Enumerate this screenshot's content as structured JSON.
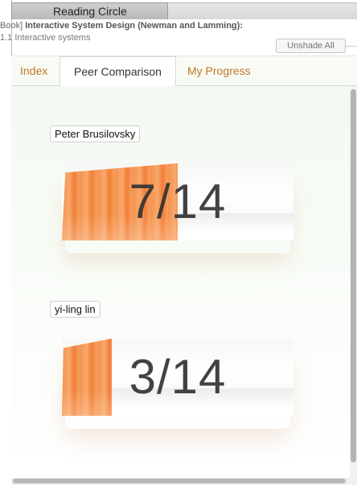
{
  "window": {
    "title": "Reading Circle"
  },
  "header": {
    "breadcrumb_prefix": "Book] ",
    "book_title": "Interactive System Design (Newman and Lamming):",
    "section": "1.1 Interactive systems",
    "unshade_label": "Unshade All"
  },
  "tabs": [
    {
      "label": "Index",
      "active": false
    },
    {
      "label": "Peer Comparison",
      "active": true
    },
    {
      "label": "My Progress",
      "active": false
    }
  ],
  "peers": [
    {
      "name": "Peter Brusilovsky",
      "completed": 7,
      "total": 14,
      "label": "7/14"
    },
    {
      "name": "yi-ling lin",
      "completed": 3,
      "total": 14,
      "label": "3/14"
    }
  ],
  "colors": {
    "accent": "#c0772a",
    "progress_fill": "#f4924d"
  }
}
